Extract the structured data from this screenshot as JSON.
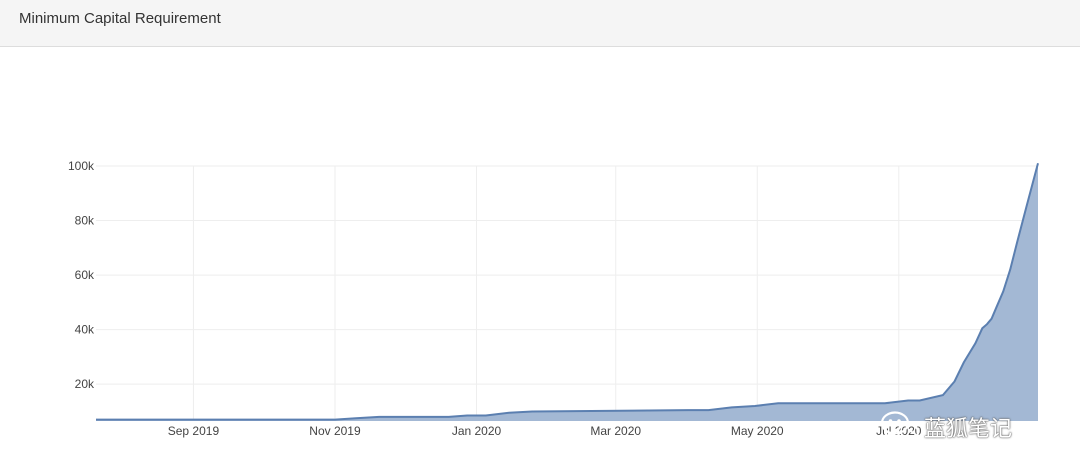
{
  "panel": {
    "title": "Minimum Capital Requirement"
  },
  "watermark": {
    "text": "蓝狐笔记",
    "icon": "wechat-icon"
  },
  "colors": {
    "line": "#5b7fb0",
    "fill": "#a3b8d4",
    "grid": "#eeeeee"
  },
  "chart_data": {
    "type": "area",
    "title": "",
    "xlabel": "",
    "ylabel": "",
    "grid": true,
    "x_ticks": [
      {
        "date": "2019-09-01",
        "label": "Sep 2019"
      },
      {
        "date": "2019-11-01",
        "label": "Nov 2019"
      },
      {
        "date": "2020-01-01",
        "label": "Jan 2020"
      },
      {
        "date": "2020-03-01",
        "label": "Mar 2020"
      },
      {
        "date": "2020-05-01",
        "label": "May 2020"
      },
      {
        "date": "2020-07-01",
        "label": "Jul 2020"
      }
    ],
    "y_ticks": [
      {
        "value": 20000,
        "label": "20k"
      },
      {
        "value": 40000,
        "label": "40k"
      },
      {
        "value": 60000,
        "label": "60k"
      },
      {
        "value": 80000,
        "label": "80k"
      },
      {
        "value": 100000,
        "label": "100k"
      }
    ],
    "xlim": [
      "2019-07-21",
      "2020-08-01"
    ],
    "ylim": [
      6500,
      101000
    ],
    "series": [
      {
        "points": [
          [
            "2019-07-21",
            7000
          ],
          [
            "2019-11-01",
            7000
          ],
          [
            "2019-11-10",
            7500
          ],
          [
            "2019-11-20",
            8000
          ],
          [
            "2019-12-20",
            8000
          ],
          [
            "2019-12-28",
            8500
          ],
          [
            "2020-01-05",
            8500
          ],
          [
            "2020-01-15",
            9500
          ],
          [
            "2020-01-25",
            10000
          ],
          [
            "2020-04-01",
            10500
          ],
          [
            "2020-04-10",
            10500
          ],
          [
            "2020-04-20",
            11500
          ],
          [
            "2020-04-30",
            12000
          ],
          [
            "2020-05-10",
            13000
          ],
          [
            "2020-06-25",
            13000
          ],
          [
            "2020-07-05",
            14000
          ],
          [
            "2020-07-10",
            14000
          ],
          [
            "2020-07-20",
            16000
          ],
          [
            "2020-07-25",
            21000
          ],
          [
            "2020-07-29",
            28000
          ],
          [
            "2020-08-03",
            35000
          ],
          [
            "2020-08-06",
            40500
          ],
          [
            "2020-08-08",
            42000
          ],
          [
            "2020-08-10",
            44000
          ],
          [
            "2020-08-12",
            48000
          ],
          [
            "2020-08-15",
            54000
          ],
          [
            "2020-08-18",
            62000
          ],
          [
            "2020-08-21",
            72000
          ],
          [
            "2020-08-25",
            85000
          ],
          [
            "2020-08-30",
            101000
          ]
        ]
      }
    ]
  }
}
